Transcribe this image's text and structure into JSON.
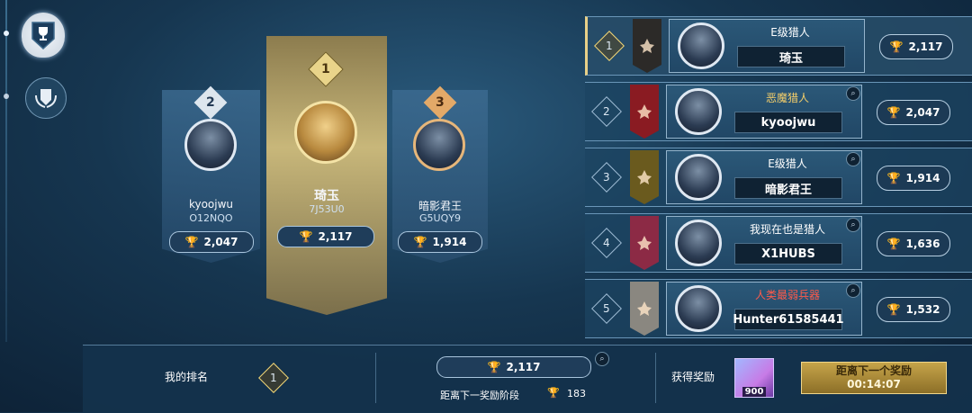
{
  "side_tabs": [
    {
      "icon": "trophy-shield-icon",
      "active": true
    },
    {
      "icon": "laurel-shield-icon",
      "active": false
    }
  ],
  "podium": [
    {
      "rank": "2",
      "name": "kyoojwu",
      "code": "O12NQO",
      "score": "2,047"
    },
    {
      "rank": "1",
      "name": "琦玉",
      "code": "7J53U0",
      "score": "2,117"
    },
    {
      "rank": "3",
      "name": "暗影君王",
      "code": "G5UQY9",
      "score": "1,914"
    }
  ],
  "leaderboard": [
    {
      "rank": "1",
      "title": "E级猎人",
      "title_color": "#ffffff",
      "name": "琦玉",
      "score": "2,117",
      "banner": "#2c2a28"
    },
    {
      "rank": "2",
      "title": "恶魔猎人",
      "title_color": "#f5cf6a",
      "name": "kyoojwu",
      "score": "2,047",
      "banner": "#8a1b22"
    },
    {
      "rank": "3",
      "title": "E级猎人",
      "title_color": "#ffffff",
      "name": "暗影君王",
      "score": "1,914",
      "banner": "#6a5a1e"
    },
    {
      "rank": "4",
      "title": "我现在也是猎人",
      "title_color": "#ffffff",
      "name": "X1HUBS",
      "score": "1,636",
      "banner": "#8c2a45"
    },
    {
      "rank": "5",
      "title": "人类最弱兵器",
      "title_color": "#ff5a4a",
      "name": "Hunter61585441",
      "score": "1,532",
      "banner": "#8a8780"
    }
  ],
  "bottom": {
    "my_rank_label": "我的排名",
    "my_rank": "1",
    "my_score": "2,117",
    "next_stage_label": "距离下一奖励阶段",
    "next_stage_value": "183",
    "reward_label": "获得奖励",
    "reward_amount": "900",
    "next_reward_line1": "距离下一个奖励",
    "next_reward_timer": "00:14:07"
  }
}
